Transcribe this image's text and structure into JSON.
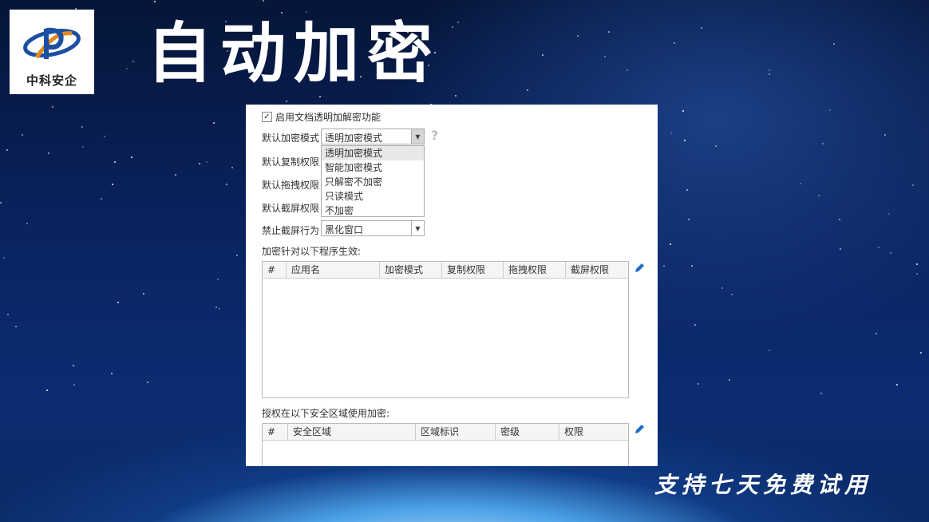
{
  "brand": {
    "logo_text": "中科安企"
  },
  "slide_title": "自动加密",
  "slogan": "支持七天免费试用",
  "panel": {
    "enable_checkbox": {
      "label": "启用文档透明加解密功能",
      "checked": true
    },
    "fields": [
      {
        "label": "默认加密模式",
        "value": "透明加密模式",
        "open": true
      },
      {
        "label": "默认复制权限",
        "value": ""
      },
      {
        "label": "默认拖拽权限",
        "value": ""
      },
      {
        "label": "默认截屏权限",
        "value": ""
      },
      {
        "label": "禁止截屏行为",
        "value": "黑化窗口"
      }
    ],
    "help_symbol": "?",
    "mode_options": [
      "透明加密模式",
      "智能加密模式",
      "只解密不加密",
      "只读模式",
      "不加密"
    ],
    "selected_option": "透明加密模式",
    "programs_section": {
      "label": "加密针对以下程序生效:",
      "columns": [
        "#",
        "应用名",
        "加密模式",
        "复制权限",
        "拖拽权限",
        "截屏权限"
      ]
    },
    "zones_section": {
      "label": "授权在以下安全区域使用加密:",
      "columns": [
        "#",
        "安全区域",
        "区域标识",
        "密级",
        "权限"
      ]
    }
  },
  "colors": {
    "accent": "#1f6fc8",
    "logo_blue": "#1b4fa3",
    "logo_orange": "#e08a1e"
  }
}
